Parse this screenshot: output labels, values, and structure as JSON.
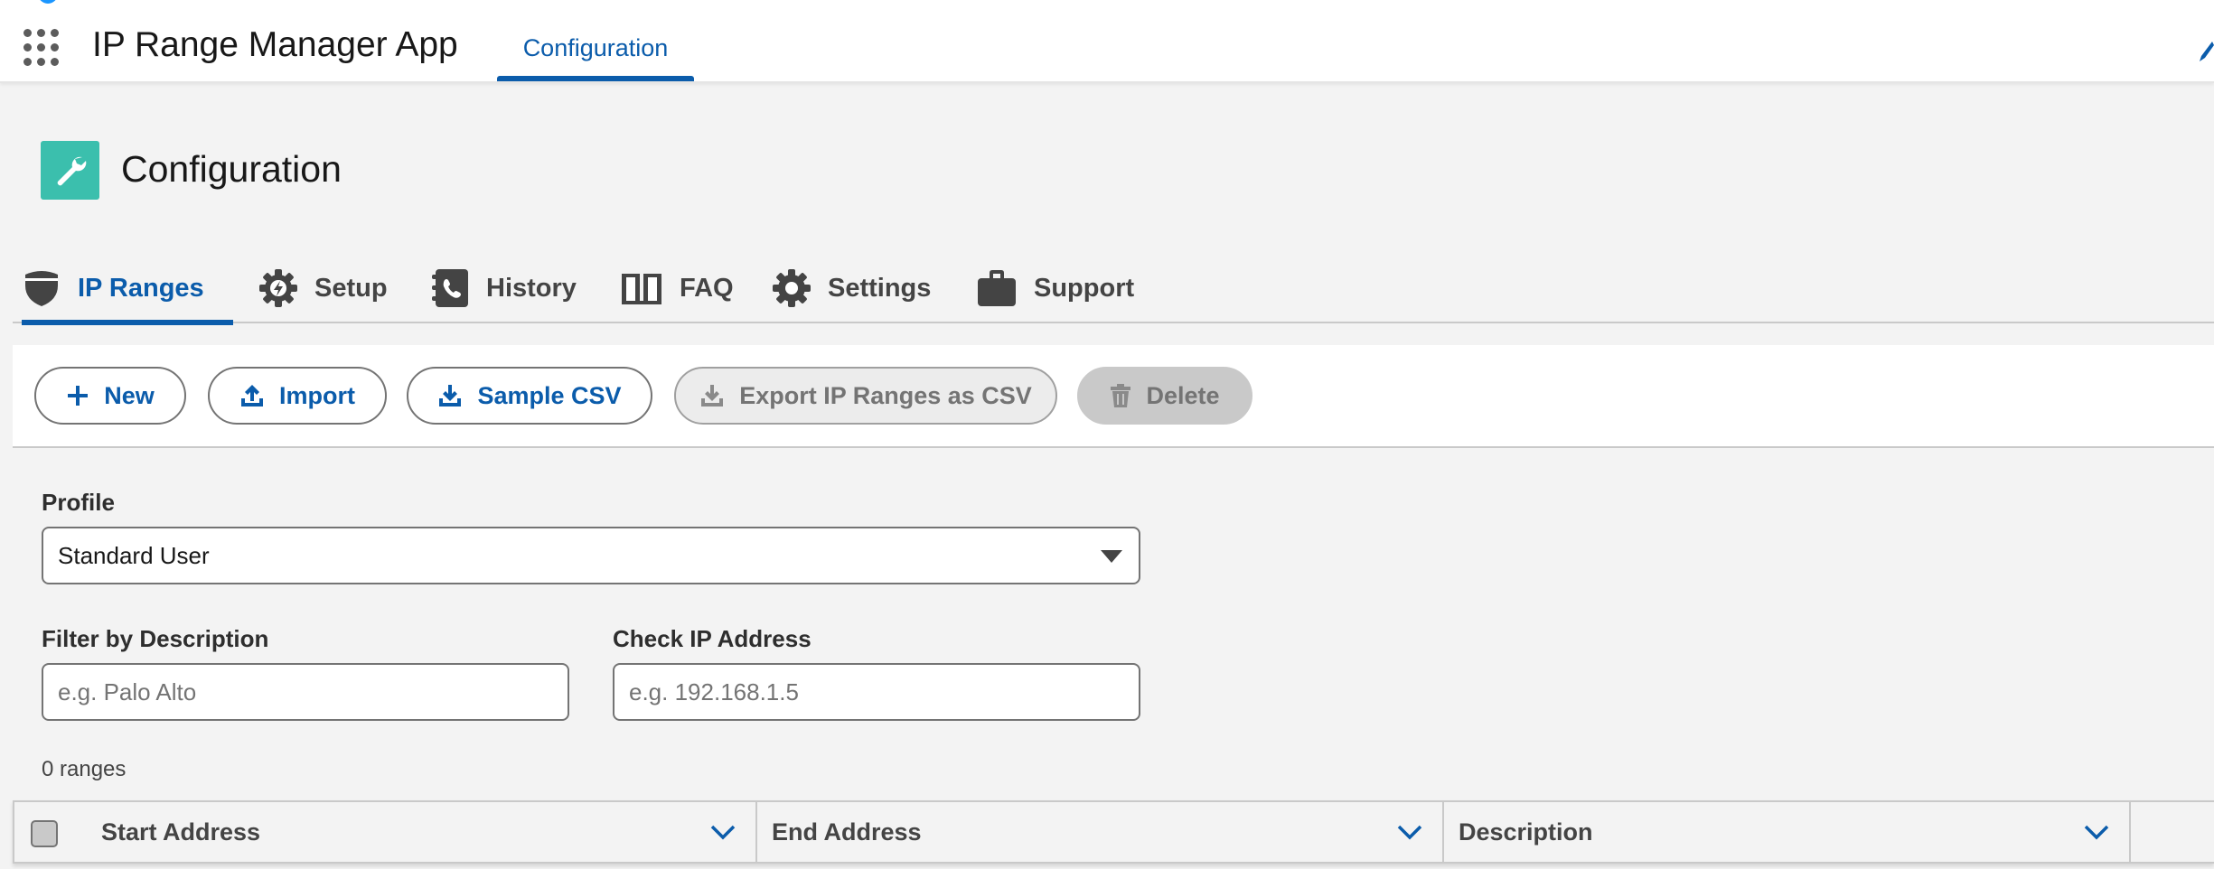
{
  "header": {
    "app_name": "IP Range Manager App",
    "nav_tab": "Configuration"
  },
  "page": {
    "title": "Configuration",
    "icon": "wrench-icon"
  },
  "tabs": [
    {
      "label": "IP Ranges",
      "icon": "shield-icon",
      "active": true
    },
    {
      "label": "Setup",
      "icon": "gear-bolt-icon",
      "active": false
    },
    {
      "label": "History",
      "icon": "address-book-icon",
      "active": false
    },
    {
      "label": "FAQ",
      "icon": "book-icon",
      "active": false
    },
    {
      "label": "Settings",
      "icon": "gear-icon",
      "active": false
    },
    {
      "label": "Support",
      "icon": "briefcase-icon",
      "active": false
    }
  ],
  "toolbar": {
    "new_label": "New",
    "import_label": "Import",
    "sample_csv_label": "Sample CSV",
    "export_label": "Export IP Ranges as CSV",
    "delete_label": "Delete"
  },
  "form": {
    "profile_label": "Profile",
    "profile_value": "Standard User",
    "filter_label": "Filter by Description",
    "filter_placeholder": "e.g. Palo Alto",
    "check_ip_label": "Check IP Address",
    "check_ip_placeholder": "e.g. 192.168.1.5"
  },
  "results": {
    "count_text": "0 ranges"
  },
  "table": {
    "columns": [
      "Start Address",
      "End Address",
      "Description"
    ]
  },
  "colors": {
    "brand_blue": "#0b5cab",
    "page_icon_bg": "#3bbfad",
    "page_bg": "#f3f3f3"
  }
}
